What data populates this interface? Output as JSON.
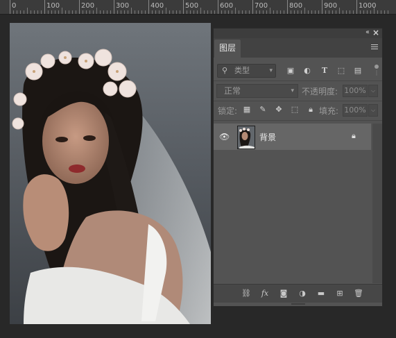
{
  "ruler": {
    "labels": [
      "0",
      "100",
      "200",
      "300",
      "400",
      "500",
      "600",
      "700",
      "800",
      "900",
      "1000"
    ]
  },
  "layers_panel": {
    "tab_label": "图层",
    "filter": {
      "label": "类型",
      "icons": [
        "image-filter-icon",
        "adjustment-filter-icon",
        "type-filter-icon",
        "shape-filter-icon",
        "smart-object-filter-icon"
      ]
    },
    "blend_mode": "正常",
    "opacity_label": "不透明度:",
    "opacity_value": "100%",
    "lock_label": "锁定:",
    "lock_icons": [
      "lock-transparent-icon",
      "lock-pixels-icon",
      "lock-position-icon",
      "lock-artboard-icon",
      "lock-all-icon"
    ],
    "fill_label": "填充:",
    "fill_value": "100%",
    "layers": [
      {
        "name": "背景",
        "visible": true,
        "locked": true
      }
    ],
    "bottom_icons": [
      "link-layers-icon",
      "fx-icon",
      "mask-icon",
      "adjustment-layer-icon",
      "group-folder-icon",
      "new-layer-icon",
      "trash-icon"
    ]
  }
}
